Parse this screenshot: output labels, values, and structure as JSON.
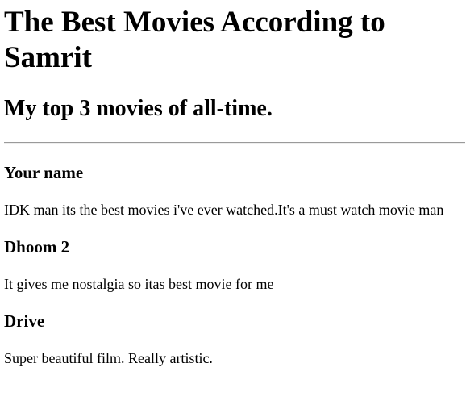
{
  "page": {
    "title": "The Best Movies According to Samrit",
    "subtitle": "My top 3 movies of all-time."
  },
  "movies": [
    {
      "name": "Your name",
      "description": "IDK man its the best movies i've ever watched.It's a must watch movie man"
    },
    {
      "name": "Dhoom 2",
      "description": "It gives me nostalgia so itas best movie for me"
    },
    {
      "name": "Drive",
      "description": "Super beautiful film. Really artistic."
    }
  ]
}
